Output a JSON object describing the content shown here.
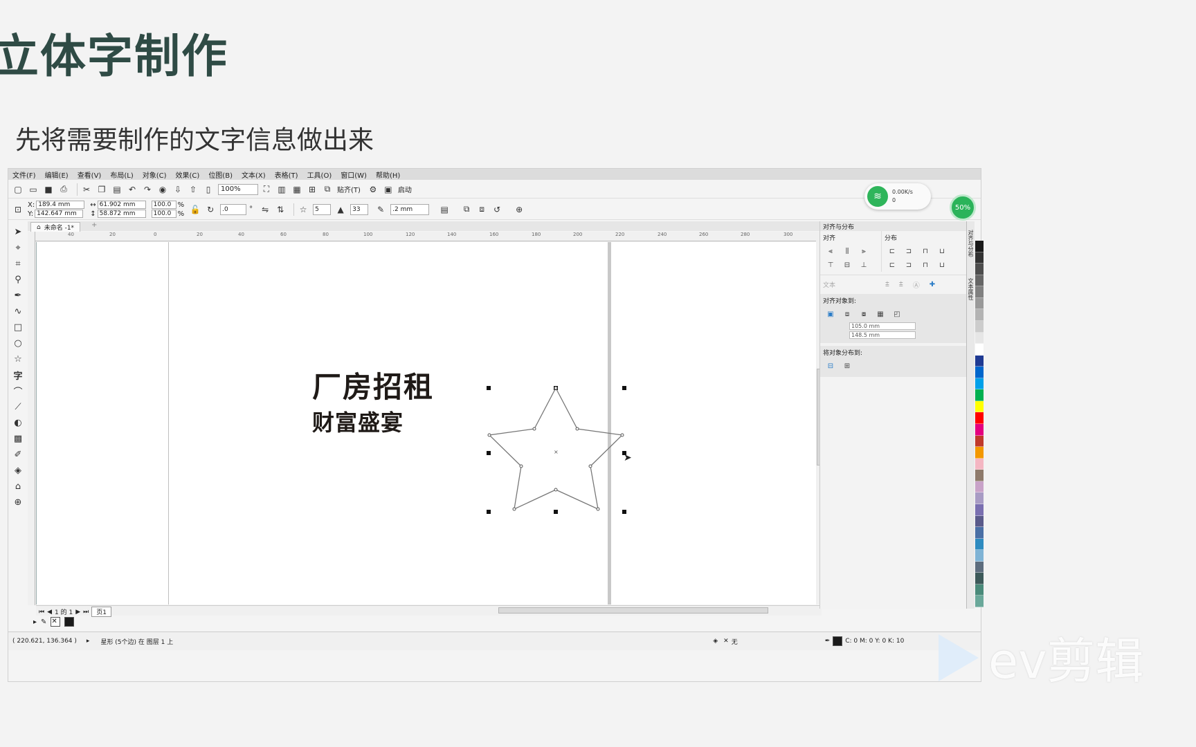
{
  "slide": {
    "title": "立体字制作",
    "subtitle": "先将需要制作的文字信息做出来"
  },
  "menu": [
    "文件(F)",
    "编辑(E)",
    "查看(V)",
    "布局(L)",
    "对象(C)",
    "效果(C)",
    "位图(B)",
    "文本(X)",
    "表格(T)",
    "工具(O)",
    "窗口(W)",
    "帮助(H)"
  ],
  "toolbar": {
    "zoom": "100%",
    "snap_label": "贴齐(T)",
    "launch_label": "启动"
  },
  "propbar": {
    "x": "189.4 mm",
    "y": "142.647 mm",
    "w": "61.902 mm",
    "h": "58.872 mm",
    "scale_w": "100.0",
    "scale_h": "100.0",
    "pct": "%",
    "rotation": ".0",
    "points": "5",
    "sharpness": "33",
    "outline": ".2 mm"
  },
  "doc_tab": "未命名 -1*",
  "ruler_ticks": [
    "40",
    "20",
    "0",
    "20",
    "40",
    "60",
    "80",
    "100",
    "120",
    "140",
    "160",
    "180",
    "200",
    "220",
    "240",
    "260",
    "280",
    "300"
  ],
  "canvas_text": {
    "line1": "厂房招租",
    "line2": "财富盛宴"
  },
  "pagenav": {
    "counter": "1 的 1",
    "page_tab": "页1"
  },
  "status": {
    "coords": "( 220.621, 136.364 )",
    "object": "星形 (5个边) 在 图层 1 上",
    "fill_none": "无",
    "color_info": "C: 0 M: 0 Y: 0 K: 10"
  },
  "docker": {
    "title": "对齐与分布",
    "align_label": "对齐",
    "distribute_label": "分布",
    "text_label": "文本",
    "align_to_label": "对齐对象到:",
    "field1": "105.0 mm",
    "field2": "148.5 mm",
    "distribute_to_label": "将对象分布到:"
  },
  "side_tabs": [
    "对齐与分布",
    "文本属性"
  ],
  "network": {
    "speed": "0.00K/s",
    "count": "0"
  },
  "cpu": "50%",
  "watermark": "ev剪辑",
  "palette_colors": [
    "#1a1a1a",
    "#333333",
    "#4d4d4d",
    "#666666",
    "#808080",
    "#999999",
    "#b3b3b3",
    "#cccccc",
    "#e6e6e6",
    "#ffffff",
    "#1f3a93",
    "#0066cc",
    "#00a0e9",
    "#00b050",
    "#ffff00",
    "#ff0000",
    "#e4007f",
    "#c0392b",
    "#f39800",
    "#f4b6c2",
    "#8e7a6b",
    "#c8a2c8",
    "#a89bc4",
    "#7a6fb0",
    "#5a5a8a",
    "#4a6fa5",
    "#2e8bc0",
    "#7fb3d5",
    "#5d6d7e",
    "#3d5a5a",
    "#4a8a7a",
    "#6aa89a"
  ],
  "colors": {
    "title": "#2f4b45",
    "accent_green": "#2fb55b"
  }
}
